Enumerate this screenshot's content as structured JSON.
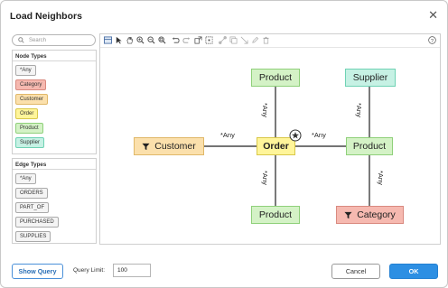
{
  "dialog": {
    "title": "Load Neighbors"
  },
  "search": {
    "placeholder": "Search"
  },
  "node_types": {
    "header": "Node Types",
    "items": [
      {
        "label": "*Any",
        "color": "#f4f4f4"
      },
      {
        "label": "Category",
        "color": "#f6b9b0"
      },
      {
        "label": "Customer",
        "color": "#fbe0ac"
      },
      {
        "label": "Order",
        "color": "#fff59a"
      },
      {
        "label": "Product",
        "color": "#d4f2c6"
      },
      {
        "label": "Supplier",
        "color": "#c6f1e4"
      }
    ]
  },
  "edge_types": {
    "header": "Edge Types",
    "items": [
      {
        "label": "*Any"
      },
      {
        "label": "ORDERS"
      },
      {
        "label": "PART_OF"
      },
      {
        "label": "PURCHASED"
      },
      {
        "label": "SUPPLIES"
      }
    ]
  },
  "toolbar": {
    "icons": [
      "layout-icon",
      "pointer-icon",
      "hand-icon",
      "zoom-in-icon",
      "zoom-out-icon",
      "zoom-fit-icon",
      "undo-icon",
      "redo-icon",
      "expand-icon",
      "select-icon",
      "link-icon",
      "copy-icon",
      "unlink-icon",
      "edit-icon",
      "delete-icon"
    ],
    "help_icon": "help-icon"
  },
  "graph": {
    "nodes": {
      "order": "Order",
      "product_top": "Product",
      "supplier": "Supplier",
      "customer": "Customer",
      "product_right": "Product",
      "product_bottom": "Product",
      "category": "Category"
    },
    "edge_labels": {
      "order_product_top": "*Any",
      "order_customer": "*Any",
      "order_product_right": "*Any",
      "order_product_bottom": "*Any",
      "supplier_product": "*Any",
      "product_category": "*Any"
    }
  },
  "footer": {
    "show_query": "Show Query",
    "query_limit_label": "Query Limit:",
    "query_limit_value": "100",
    "cancel": "Cancel",
    "ok": "OK"
  },
  "colors": {
    "accent": "#2d8fe3",
    "product": "#d4f2c6",
    "supplier": "#c6f1e4",
    "customer": "#fbe0ac",
    "category": "#f6b9b0",
    "order": "#fff59a"
  }
}
